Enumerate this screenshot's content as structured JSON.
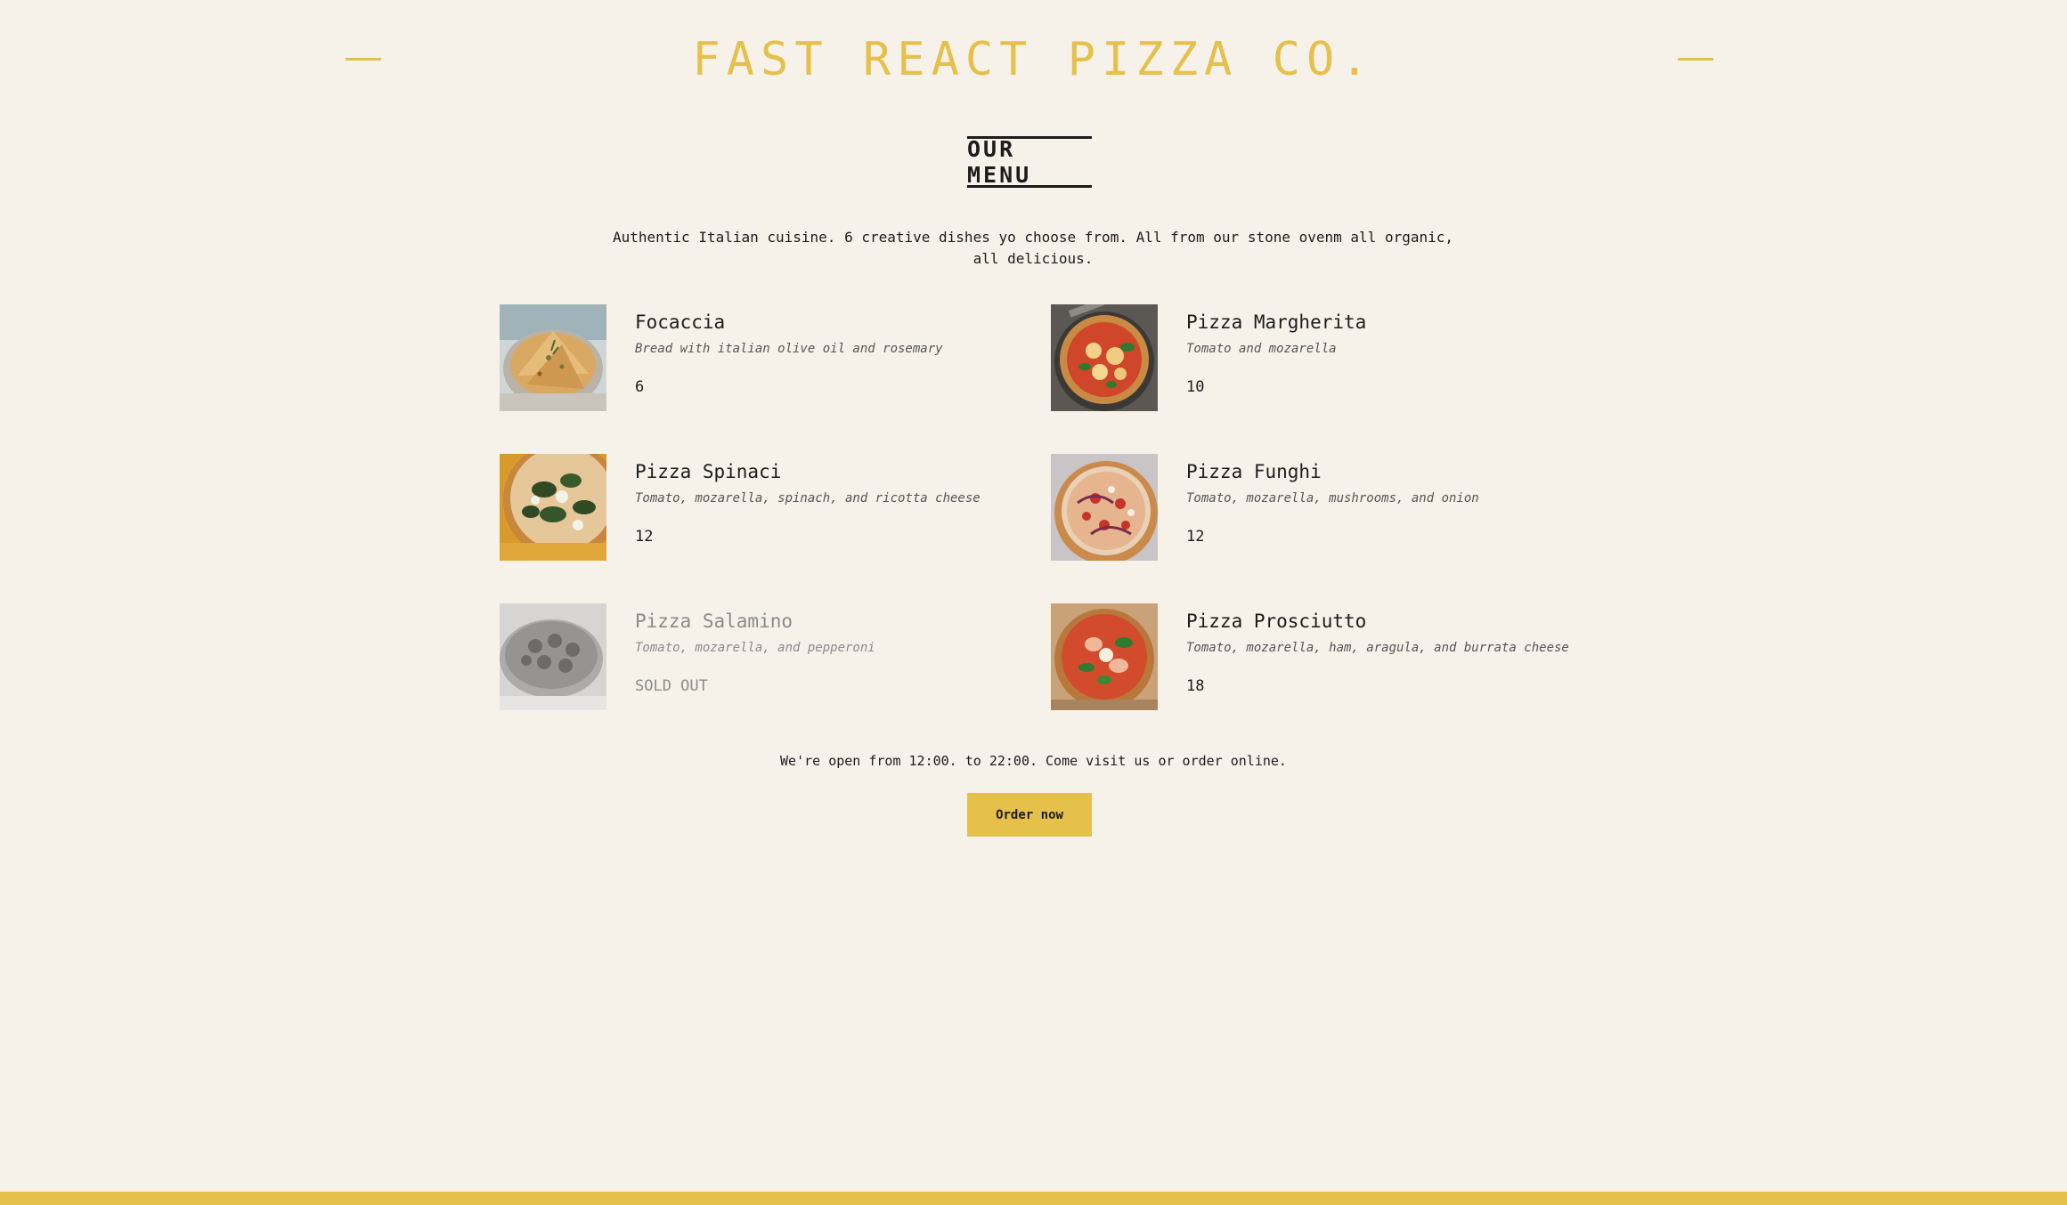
{
  "header": {
    "title": "FAST REACT PIZZA CO."
  },
  "menu": {
    "heading": "OUR MENU",
    "intro": "Authentic Italian cuisine. 6 creative dishes yo choose from. All from our stone ovenm all organic, all delicious.",
    "items": [
      {
        "name": "Focaccia",
        "description": "Bread with italian olive oil and rosemary",
        "price": "6",
        "image": "focaccia-photo"
      },
      {
        "name": "Pizza Margherita",
        "description": "Tomato and mozarella",
        "price": "10",
        "image": "pizza-margherita-photo"
      },
      {
        "name": "Pizza Spinaci",
        "description": "Tomato, mozarella, spinach, and ricotta cheese",
        "price": "12",
        "image": "pizza-spinaci-photo"
      },
      {
        "name": "Pizza Funghi",
        "description": "Tomato, mozarella, mushrooms, and onion",
        "price": "12",
        "image": "pizza-funghi-photo"
      },
      {
        "name": "Pizza Salamino",
        "description": "Tomato, mozarella, and pepperoni",
        "price": "SOLD OUT",
        "image": "pizza-salamino-photo"
      },
      {
        "name": "Pizza Prosciutto",
        "description": "Tomato, mozarella, ham, aragula, and burrata cheese",
        "price": "18",
        "image": "pizza-prosciutto-photo"
      }
    ]
  },
  "footer": {
    "hours": "We're open from 12:00. to 22:00. Come visit us or order online.",
    "order_label": "Order now"
  },
  "colors": {
    "background": "#f7f2e9",
    "accent": "#e5c04b",
    "text": "#1c1c1c"
  }
}
